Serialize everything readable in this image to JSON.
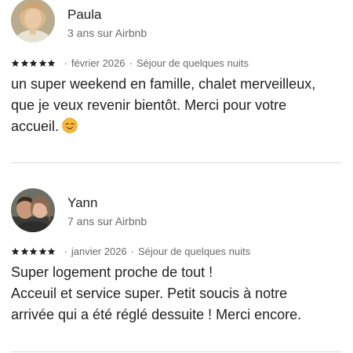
{
  "reviews": [
    {
      "name": "Paula",
      "since": "3 ans sur Airbnb",
      "rating": 5,
      "date": "février 2026",
      "stay_type": "Séjour de quelques nuits",
      "lines": [
        "un super weekend en famille,  chalet merveilleux,",
        "que je veux revenir bientôt. Merci pour votre",
        "accueil."
      ],
      "emoji": "smiling-face-icon"
    },
    {
      "name": "Yann",
      "since": "7 ans sur Airbnb",
      "rating": 5,
      "date": "janvier 2026",
      "stay_type": "Séjour de quelques nuits",
      "lines": [
        "Super logement proche de tout !",
        "Acceuil et service super. Petit soucis à notre",
        "arrivée qui a été réglé dessuite ! Merci encore."
      ]
    }
  ],
  "separator": "·",
  "colors": {
    "text": "#222222",
    "muted": "#6a6a6a",
    "divider": "#dddddd"
  }
}
